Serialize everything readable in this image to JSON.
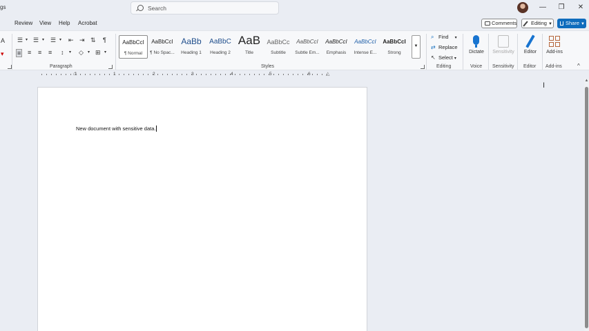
{
  "titlebar": {
    "left_fragment": "gs",
    "search_placeholder": "Search",
    "minimize": "—",
    "restore": "❐",
    "close": "✕"
  },
  "menu": {
    "items": [
      "Review",
      "View",
      "Help",
      "Acrobat"
    ],
    "comments": "Comments",
    "editing": "Editing",
    "share": "Share"
  },
  "ribbon": {
    "paragraph_label": "Paragraph",
    "styles_label": "Styles",
    "editing_label": "Editing",
    "voice_label": "Voice",
    "sensitivity_label": "Sensitivity",
    "editor_group_label": "Editor",
    "addins_group_label": "Add-ins",
    "styles": [
      {
        "sample": "AaBbCcI",
        "name": "¶ Normal"
      },
      {
        "sample": "AaBbCcI",
        "name": "¶ No Spac..."
      },
      {
        "sample": "AaBb",
        "name": "Heading 1"
      },
      {
        "sample": "AaBbC",
        "name": "Heading 2"
      },
      {
        "sample": "AaB",
        "name": "Title"
      },
      {
        "sample": "AaBbCc",
        "name": "Subtitle"
      },
      {
        "sample": "AaBbCcI",
        "name": "Subtle Em..."
      },
      {
        "sample": "AaBbCcI",
        "name": "Emphasis"
      },
      {
        "sample": "AaBbCcI",
        "name": "Intense E..."
      },
      {
        "sample": "AaBbCcI",
        "name": "Strong"
      }
    ],
    "find": "Find",
    "replace": "Replace",
    "select": "Select",
    "dictate": "Dictate",
    "sensitivity": "Sensitivity",
    "editor": "Editor",
    "addins": "Add-ins"
  },
  "ruler": {
    "numbers": [
      "1",
      "1",
      "2",
      "3",
      "4",
      "5",
      "6"
    ]
  },
  "document": {
    "text": "New document with sensitive data."
  },
  "colors": {
    "accent": "#0f6cbd",
    "chrome": "#eaedf3",
    "ribbon": "#f7f8fa"
  }
}
